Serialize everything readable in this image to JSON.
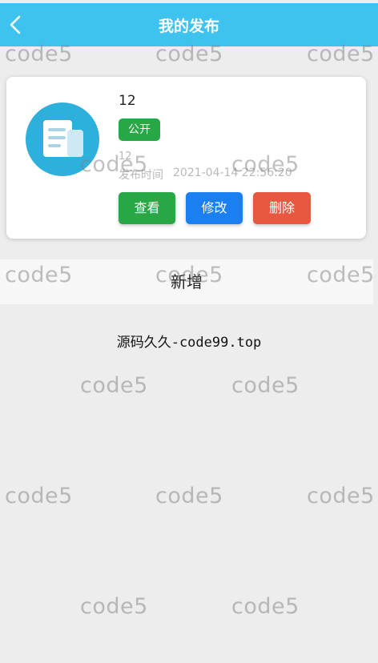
{
  "header": {
    "title": "我的发布",
    "back_icon": "chevron-left-icon"
  },
  "post": {
    "icon": "document-icon",
    "title": "12",
    "visibility_badge": "公开",
    "subtitle": "12",
    "time_label": "发布时间",
    "time_value": "2021-04-14 22:56:20",
    "actions": {
      "view": "查看",
      "edit": "修改",
      "delete": "删除"
    }
  },
  "add_button_label": "新增",
  "footer_text": "源码久久-code99.top",
  "watermark": "code5",
  "colors": {
    "header": "#3ec3ee",
    "badge": "#28a745",
    "view": "#28a745",
    "edit": "#1a7ff0",
    "delete": "#e8573f"
  }
}
